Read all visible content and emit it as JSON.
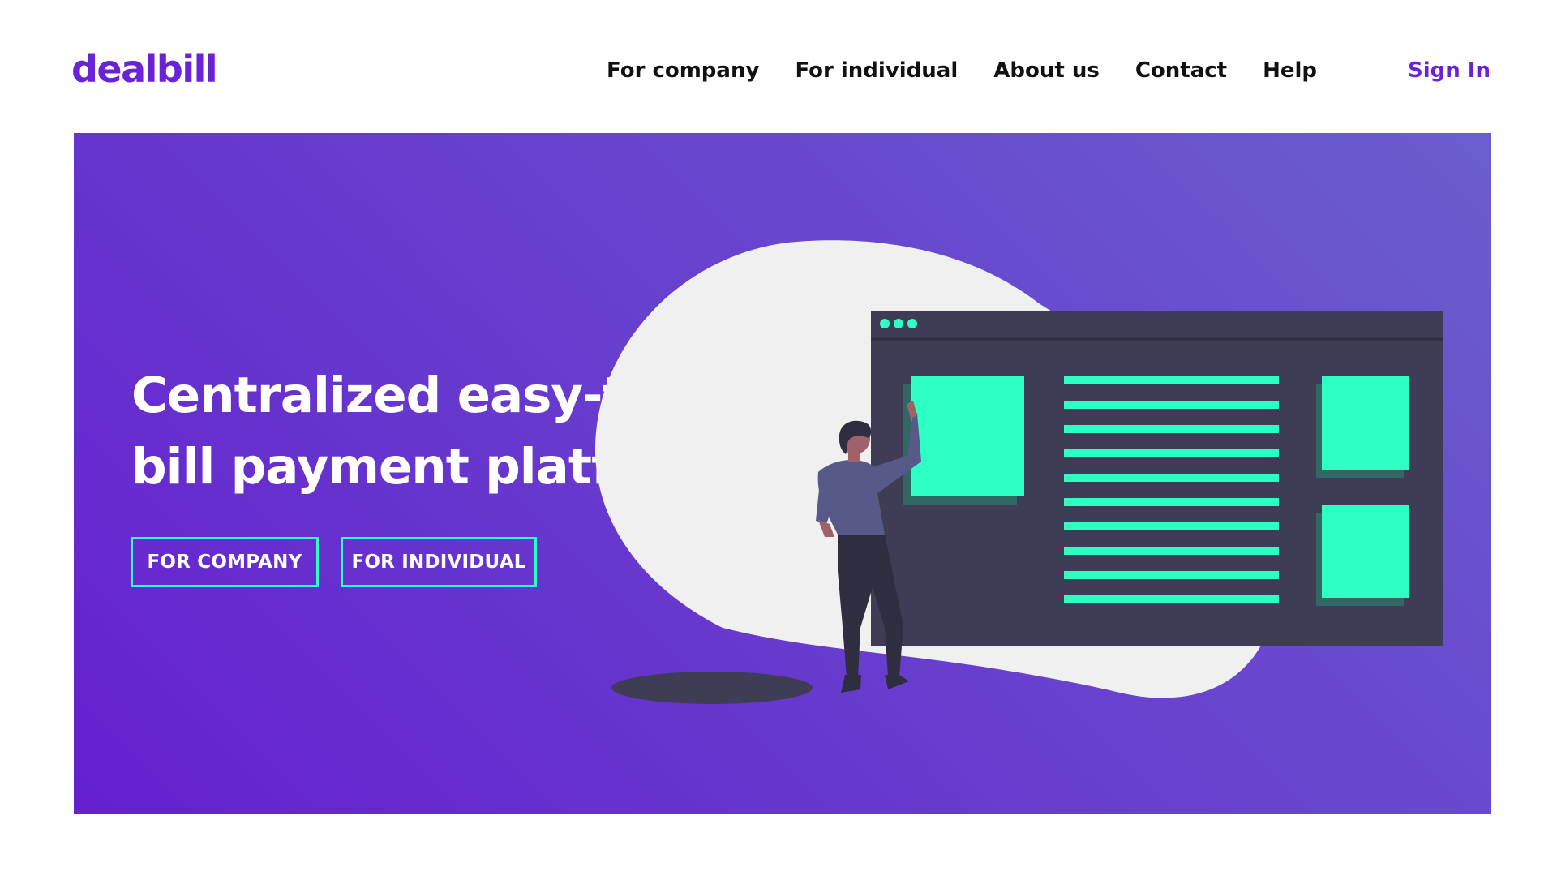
{
  "header": {
    "logo": "dealbill",
    "nav": [
      {
        "label": "For company"
      },
      {
        "label": "For individual"
      },
      {
        "label": "About us"
      },
      {
        "label": "Contact"
      },
      {
        "label": "Help"
      }
    ],
    "sign_in": "Sign In"
  },
  "hero": {
    "headline_line1": "Centralized easy-to-use",
    "headline_line2": "bill payment platform",
    "headline_period": ".",
    "buttons": {
      "company": "FOR COMPANY",
      "individual": "FOR INDIVIDUAL"
    }
  },
  "colors": {
    "brand": "#6a22d6",
    "accent": "#2effc4",
    "hero_gradient_start": "#6520cf",
    "hero_gradient_end": "#6a5ecd",
    "window_dark": "#3f3d56"
  }
}
